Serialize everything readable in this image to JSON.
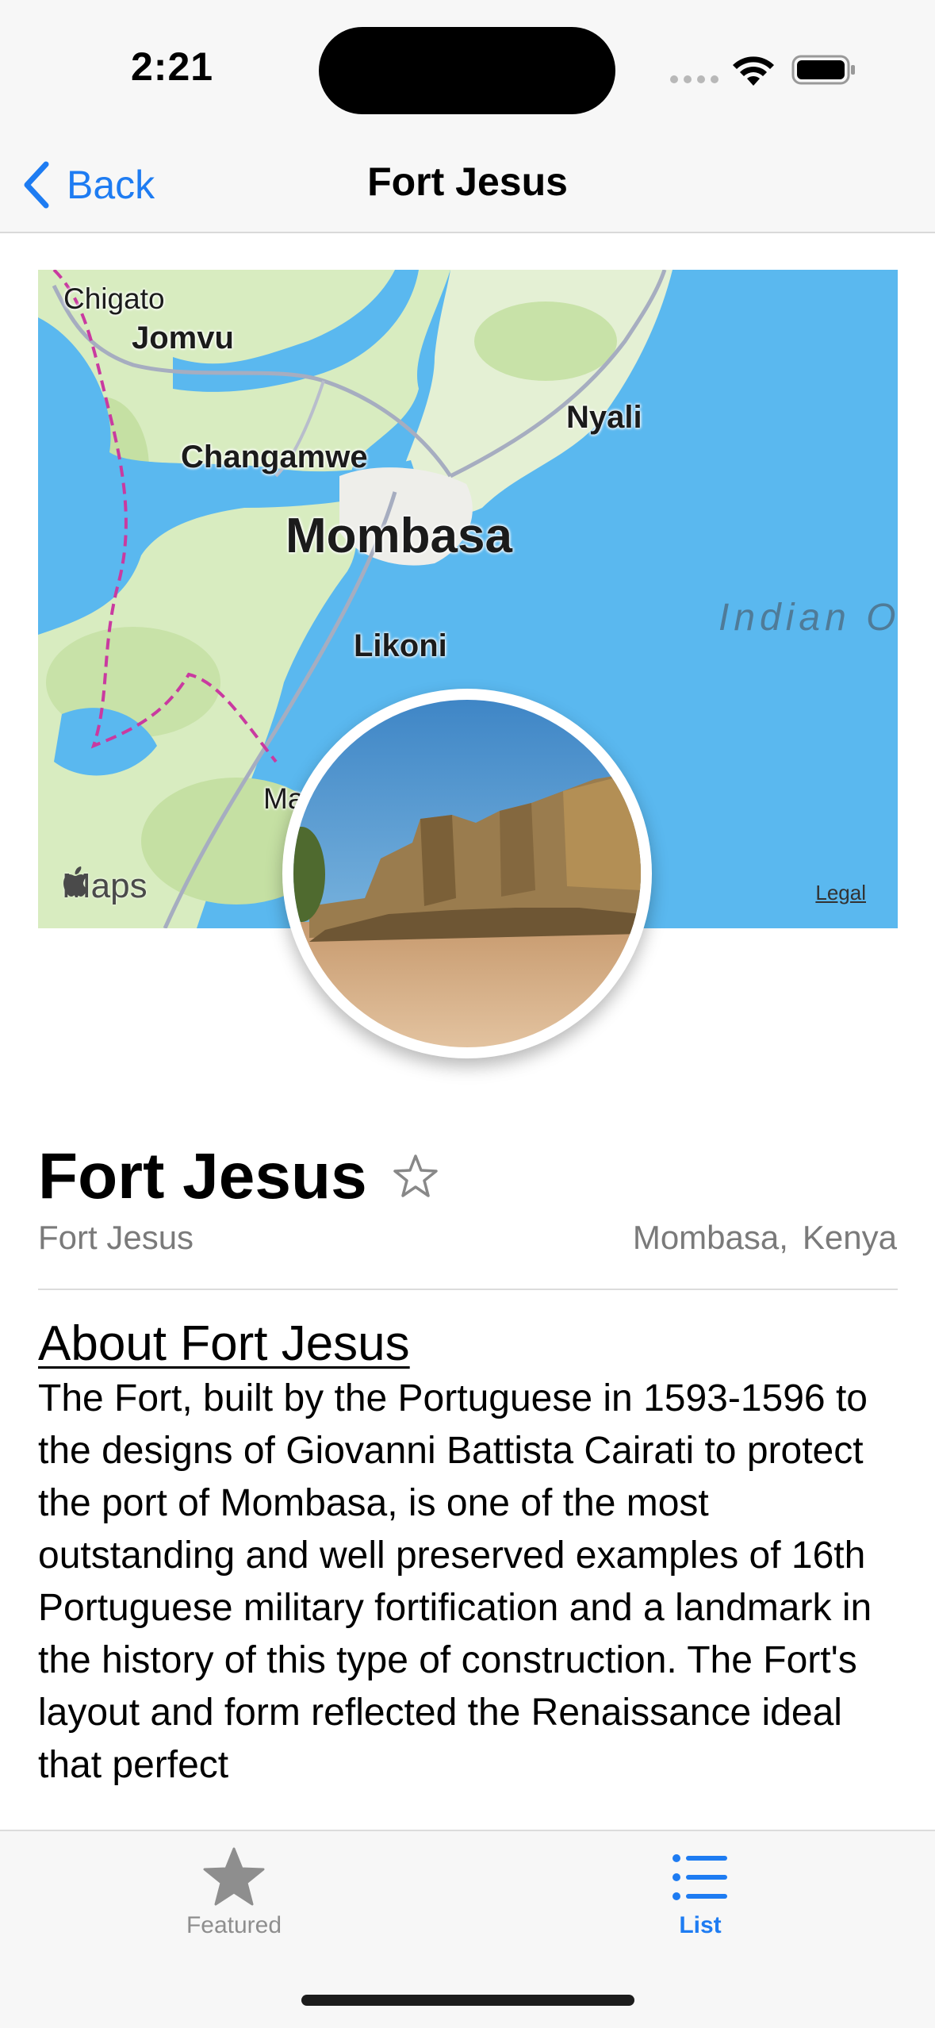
{
  "status_bar": {
    "time": "2:21"
  },
  "nav": {
    "back_label": "Back",
    "title": "Fort Jesus"
  },
  "map": {
    "labels": {
      "chigato": "Chigato",
      "jomvu": "Jomvu",
      "nyali": "Nyali",
      "changamwe": "Changamwe",
      "mombasa": "Mombasa",
      "likoni": "Likoni",
      "ma": "Ma",
      "ocean": "Indian Ocean"
    },
    "maps_logo": "Maps",
    "legal": "Legal"
  },
  "place": {
    "title": "Fort Jesus",
    "subtitle": "Fort Jesus",
    "city": "Mombasa,",
    "country": "Kenya"
  },
  "about": {
    "heading": "About Fort Jesus",
    "body": "The Fort, built by the Portuguese in 1593-1596 to the designs of Giovanni Battista Cairati to protect the port of Mombasa, is one of the most outstanding and well preserved examples of 16th Portuguese military fortification and a landmark in the history of this type of construction. The Fort's layout and form reflected the Renaissance ideal that perfect"
  },
  "tabs": [
    {
      "label": "Featured",
      "icon": "star-fill-icon",
      "selected": false
    },
    {
      "label": "List",
      "icon": "list-bullet-icon",
      "selected": true
    }
  ],
  "colors": {
    "accent": "#1e7cf2",
    "water": "#5ab8ef",
    "land": "#d9ecc2"
  }
}
